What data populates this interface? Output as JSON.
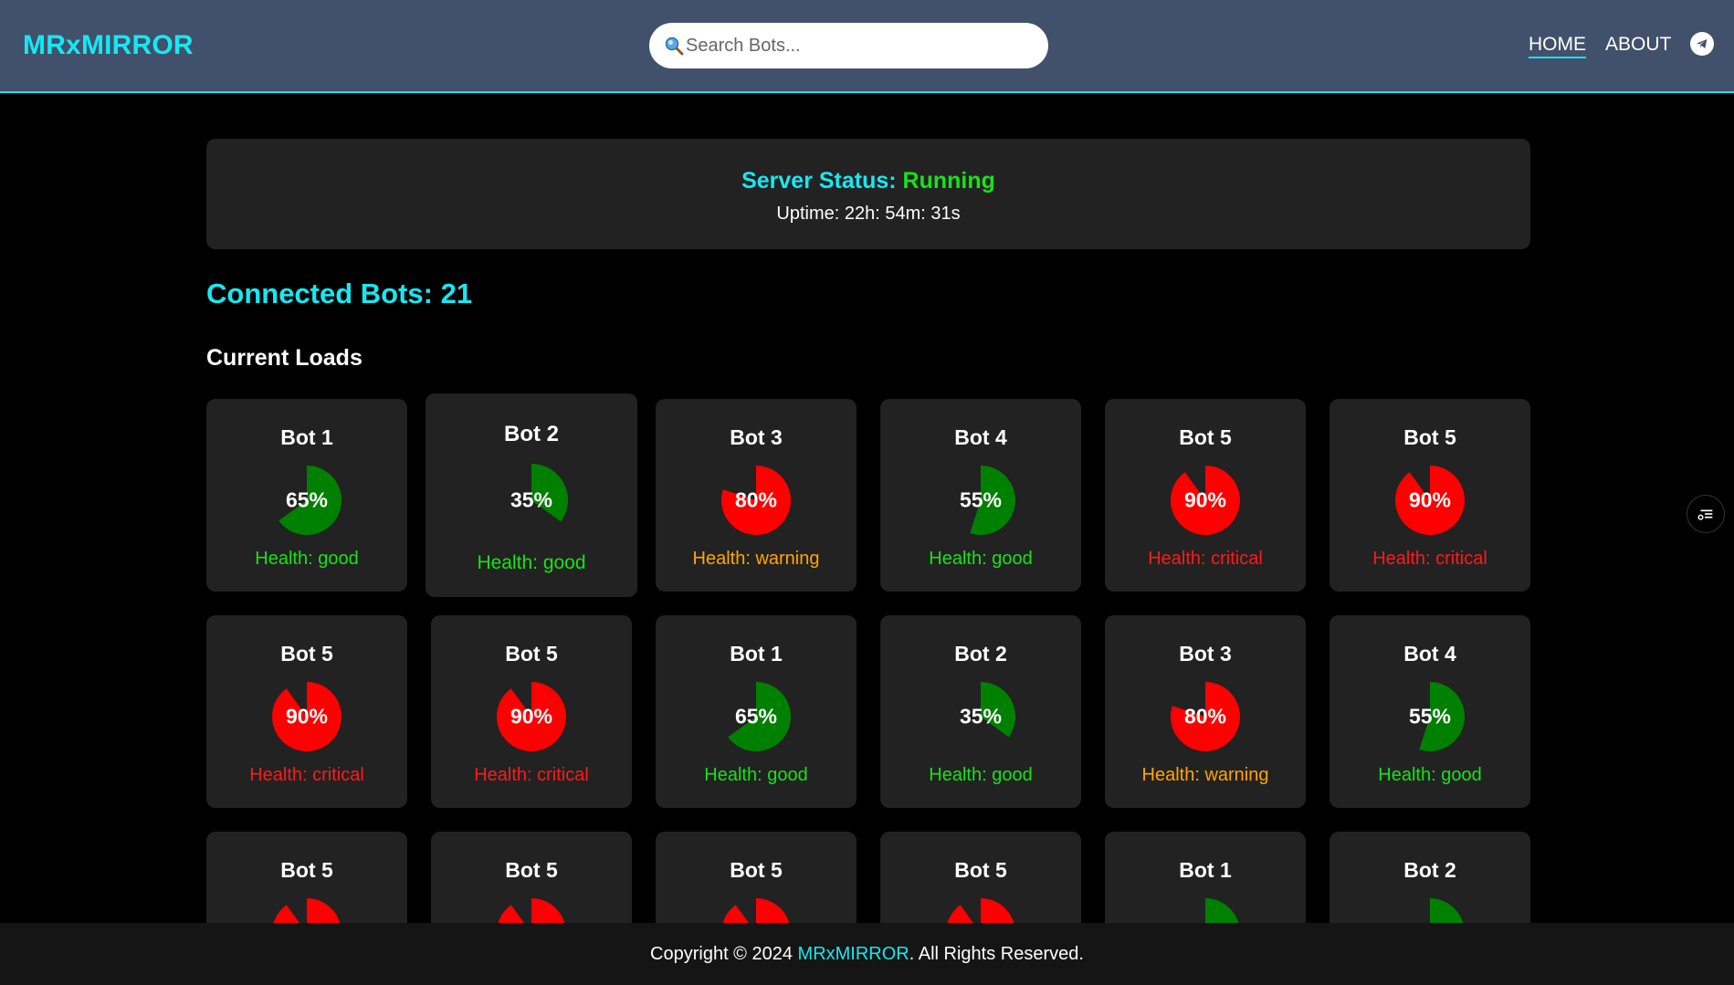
{
  "header": {
    "brand": "MRxMIRROR",
    "search_placeholder": "Search Bots...",
    "nav": {
      "home": "HOME",
      "about": "ABOUT"
    },
    "icons": {
      "search": "magnifier-icon",
      "telegram": "telegram-icon"
    }
  },
  "status": {
    "label": "Server Status: ",
    "value": "Running",
    "uptime": "Uptime: 22h: 54m: 31s"
  },
  "connected": "Connected Bots: 21",
  "loads_title": "Current Loads",
  "colors": {
    "accent": "#16e8f2",
    "good": "#16e316",
    "warning": "#ffa500",
    "critical": "#ff1a1a",
    "pie_good": "#008000",
    "pie_critical": "#ff0000"
  },
  "bots": [
    {
      "name": "Bot 1",
      "load": 65,
      "load_label": "65%",
      "health": "Health: good",
      "status": "good"
    },
    {
      "name": "Bot 2",
      "load": 35,
      "load_label": "35%",
      "health": "Health: good",
      "status": "good"
    },
    {
      "name": "Bot 3",
      "load": 80,
      "load_label": "80%",
      "health": "Health: warning",
      "status": "warning"
    },
    {
      "name": "Bot 4",
      "load": 55,
      "load_label": "55%",
      "health": "Health: good",
      "status": "good"
    },
    {
      "name": "Bot 5",
      "load": 90,
      "load_label": "90%",
      "health": "Health: critical",
      "status": "critical"
    },
    {
      "name": "Bot 5",
      "load": 90,
      "load_label": "90%",
      "health": "Health: critical",
      "status": "critical"
    },
    {
      "name": "Bot 5",
      "load": 90,
      "load_label": "90%",
      "health": "Health: critical",
      "status": "critical"
    },
    {
      "name": "Bot 5",
      "load": 90,
      "load_label": "90%",
      "health": "Health: critical",
      "status": "critical"
    },
    {
      "name": "Bot 1",
      "load": 65,
      "load_label": "65%",
      "health": "Health: good",
      "status": "good"
    },
    {
      "name": "Bot 2",
      "load": 35,
      "load_label": "35%",
      "health": "Health: good",
      "status": "good"
    },
    {
      "name": "Bot 3",
      "load": 80,
      "load_label": "80%",
      "health": "Health: warning",
      "status": "warning"
    },
    {
      "name": "Bot 4",
      "load": 55,
      "load_label": "55%",
      "health": "Health: good",
      "status": "good"
    },
    {
      "name": "Bot 5",
      "load": 90,
      "status": "critical"
    },
    {
      "name": "Bot 5",
      "load": 90,
      "status": "critical"
    },
    {
      "name": "Bot 5",
      "load": 90,
      "status": "critical"
    },
    {
      "name": "Bot 5",
      "load": 90,
      "status": "critical"
    },
    {
      "name": "Bot 1",
      "load": 65,
      "status": "good"
    },
    {
      "name": "Bot 2",
      "load": 35,
      "status": "good"
    }
  ],
  "footer": {
    "prefix": "Copyright © 2024 ",
    "brand": "MRxMIRROR",
    "suffix": ". All Rights Reserved."
  },
  "side_button_icon": "settings-list-icon"
}
